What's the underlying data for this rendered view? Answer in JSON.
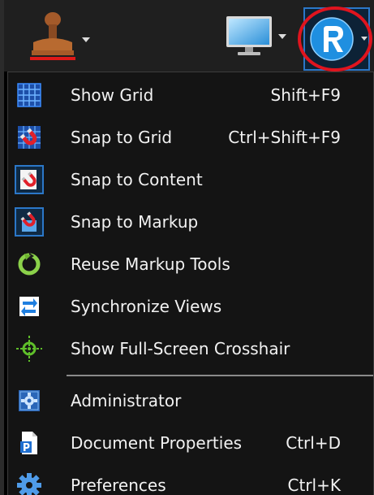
{
  "toolbar": {
    "stamp_icon": "stamp-icon",
    "monitor_icon": "monitor-icon",
    "logo_icon": "bluebeam-logo-icon"
  },
  "menu": {
    "items": [
      {
        "label": "Show Grid",
        "shortcut": "Shift+F9",
        "icon": "grid-icon"
      },
      {
        "label": "Snap to Grid",
        "shortcut": "Ctrl+Shift+F9",
        "icon": "snap-grid-icon"
      },
      {
        "label": "Snap to Content",
        "shortcut": "",
        "icon": "snap-content-icon",
        "checked": true
      },
      {
        "label": "Snap to Markup",
        "shortcut": "",
        "icon": "snap-markup-icon",
        "checked": true
      },
      {
        "label": "Reuse Markup Tools",
        "shortcut": "",
        "icon": "reuse-icon"
      },
      {
        "label": "Synchronize Views",
        "shortcut": "",
        "icon": "sync-icon"
      },
      {
        "label": "Show Full-Screen Crosshair",
        "shortcut": "",
        "icon": "crosshair-icon"
      },
      {
        "label": "Administrator",
        "shortcut": "",
        "icon": "administrator-icon"
      },
      {
        "label": "Document Properties",
        "shortcut": "Ctrl+D",
        "icon": "document-properties-icon"
      },
      {
        "label": "Preferences",
        "shortcut": "Ctrl+K",
        "icon": "gear-icon"
      }
    ]
  },
  "colors": {
    "accent": "#2b77c8",
    "highlight_ring": "#e0141e",
    "menu_bg": "#141414",
    "toolbar_bg": "#1f1f1f"
  }
}
